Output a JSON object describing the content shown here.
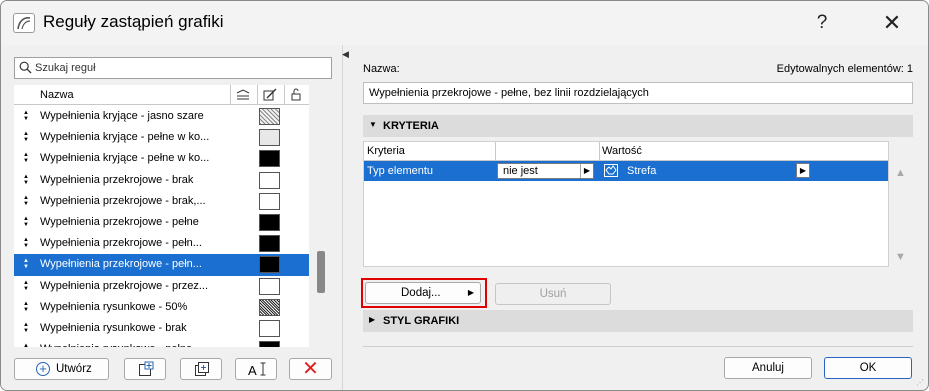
{
  "window": {
    "title": "Reguły zastąpień grafiki",
    "help_label": "?",
    "close_label": "✕"
  },
  "search": {
    "placeholder": "Szukaj reguł",
    "value": ""
  },
  "list": {
    "header": {
      "name": "Nazwa"
    },
    "rows": [
      {
        "label": "Wypełnienia kryjące - jasno szare",
        "swatch": "dots",
        "selected": false
      },
      {
        "label": "Wypełnienia kryjące - pełne w ko...",
        "swatch": "light",
        "selected": false
      },
      {
        "label": "Wypełnienia kryjące - pełne w ko...",
        "swatch": "black",
        "selected": false
      },
      {
        "label": "Wypełnienia przekrojowe - brak",
        "swatch": "white",
        "selected": false
      },
      {
        "label": "Wypełnienia przekrojowe - brak,...",
        "swatch": "white",
        "selected": false
      },
      {
        "label": "Wypełnienia przekrojowe - pełne",
        "swatch": "black",
        "selected": false
      },
      {
        "label": "Wypełnienia przekrojowe - pełn...",
        "swatch": "black",
        "selected": false
      },
      {
        "label": "Wypełnienia przekrojowe - pełn...",
        "swatch": "black",
        "selected": true
      },
      {
        "label": "Wypełnienia przekrojowe - przez...",
        "swatch": "white",
        "selected": false
      },
      {
        "label": "Wypełnienia rysunkowe - 50%",
        "swatch": "check",
        "selected": false
      },
      {
        "label": "Wypełnienia rysunkowe - brak",
        "swatch": "white",
        "selected": false
      },
      {
        "label": "Wypełnienia rysunkowe - pełne",
        "swatch": "black",
        "selected": false
      }
    ]
  },
  "left_buttons": {
    "create": "Utwórz",
    "rename_glyph": "A",
    "delete_glyph": "✕"
  },
  "detail": {
    "name_label": "Nazwa:",
    "editable_label": "Edytowalnych elementów: 1",
    "name_value": "Wypełnienia przekrojowe - pełne, bez linii rozdzielających",
    "criteria_section": "KRYTERIA",
    "criteria_columns": {
      "criteria": "Kryteria",
      "value": "Wartość"
    },
    "criteria_row": {
      "criterion": "Typ elementu",
      "operator": "nie jest",
      "value": "Strefa"
    },
    "add_label": "Dodaj...",
    "remove_label": "Usuń",
    "style_section": "STYL GRAFIKI",
    "cancel_label": "Anuluj",
    "ok_label": "OK"
  },
  "colors": {
    "selection": "#1a6fd0",
    "highlight": "#e00000",
    "delete": "#e02020"
  }
}
